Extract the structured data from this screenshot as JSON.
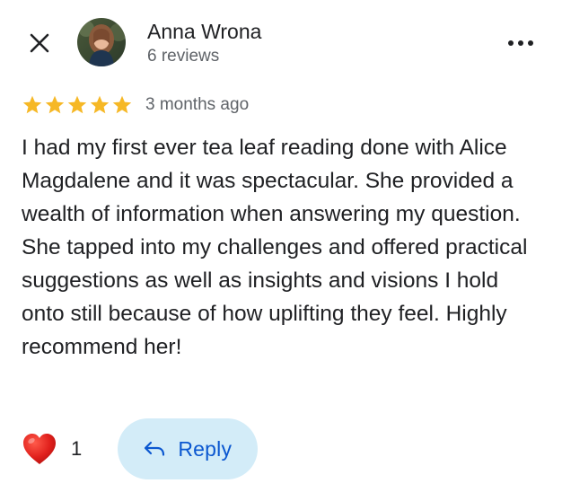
{
  "reviewer": {
    "name": "Anna Wrona",
    "reviews_count": "6 reviews"
  },
  "rating": {
    "stars": 5,
    "max_stars": 5,
    "time_ago": "3 months ago"
  },
  "review": {
    "text": "I had my first ever tea leaf reading done with Alice Magdalene and it was spectacular. She provided a wealth of information when answering my question. She tapped into my challenges and offered practical suggestions as well as insights and visions I hold onto still because of how uplifting they feel. Highly recommend her!"
  },
  "actions": {
    "like_count": "1",
    "reply_label": "Reply"
  },
  "icons": {
    "close": "close-icon",
    "more": "more-vertical-dots-icon",
    "star": "star-icon",
    "heart": "heart-icon",
    "reply": "reply-arrow-icon"
  },
  "colors": {
    "star": "#f6b826",
    "heart": "#e0201c",
    "reply_bg": "#d3ecf8",
    "reply_text": "#0b57d0",
    "secondary_text": "#5f6368"
  }
}
